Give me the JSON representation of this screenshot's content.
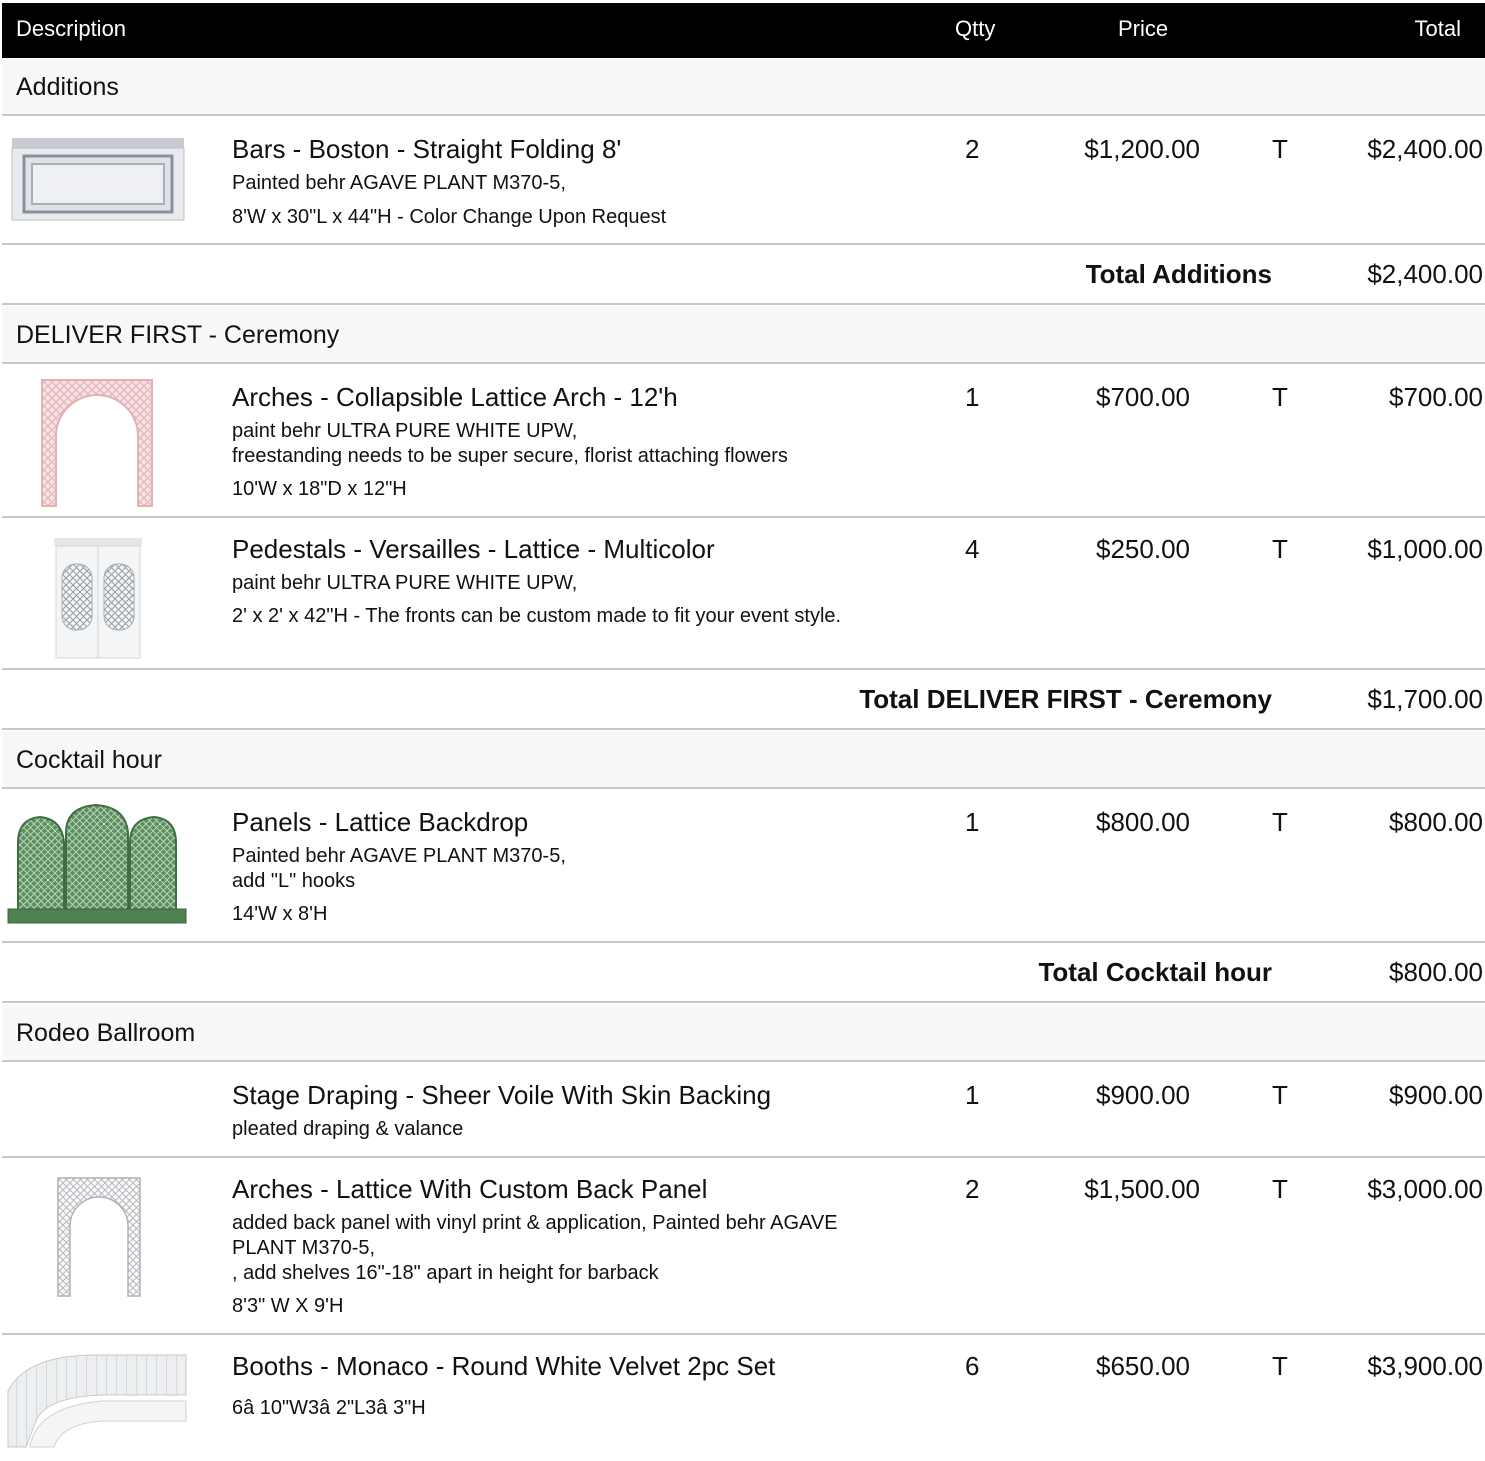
{
  "header": {
    "description": "Description",
    "qtty": "Qtty",
    "price": "Price",
    "total": "Total"
  },
  "sections": {
    "additions": {
      "title": "Additions",
      "items": [
        {
          "name": "Bars - Boston - Straight Folding 8'",
          "lines": [
            "Painted behr AGAVE PLANT M370-5,",
            "8'W x 30\"L x 44\"H - Color Change Upon Request"
          ],
          "qty": "2",
          "price": "$1,200.00",
          "tax": "T",
          "total": "$2,400.00"
        }
      ],
      "total_label": "Total Additions",
      "total_amount": "$2,400.00"
    },
    "ceremony": {
      "title": "DELIVER FIRST - Ceremony",
      "items": [
        {
          "name": "Arches - Collapsible Lattice Arch - 12'h",
          "lines": [
            "paint  behr ULTRA PURE WHITE UPW,",
            "freestanding needs to be super secure, florist attaching flowers",
            "10'W x 18\"D x 12\"H"
          ],
          "qty": "1",
          "price": "$700.00",
          "tax": "T",
          "total": "$700.00"
        },
        {
          "name": "Pedestals - Versailles - Lattice - Multicolor",
          "lines": [
            "paint  behr ULTRA PURE WHITE UPW,",
            "2' x 2' x 42\"H - The fronts can be custom made to fit your event style."
          ],
          "qty": "4",
          "price": "$250.00",
          "tax": "T",
          "total": "$1,000.00"
        }
      ],
      "total_label": "Total DELIVER FIRST - Ceremony",
      "total_amount": "$1,700.00"
    },
    "cocktail": {
      "title": "Cocktail hour",
      "items": [
        {
          "name": "Panels - Lattice Backdrop",
          "lines": [
            "Painted behr AGAVE PLANT M370-5,",
            "add \"L\" hooks",
            "14'W x 8'H"
          ],
          "qty": "1",
          "price": "$800.00",
          "tax": "T",
          "total": "$800.00"
        }
      ],
      "total_label": "Total Cocktail hour",
      "total_amount": "$800.00"
    },
    "rodeo": {
      "title": "Rodeo Ballroom",
      "items": [
        {
          "name": "Stage Draping - Sheer Voile With Skin Backing",
          "lines": [
            "pleated draping & valance"
          ],
          "qty": "1",
          "price": "$900.00",
          "tax": "T",
          "total": "$900.00"
        },
        {
          "name": "Arches - Lattice With Custom Back Panel",
          "lines": [
            "added back panel with vinyl print & application,  Painted behr AGAVE",
            "PLANT M370-5,",
            ", add shelves 16\"-18\" apart in height for barback",
            "8'3\" W X 9'H"
          ],
          "qty": "2",
          "price": "$1,500.00",
          "tax": "T",
          "total": "$3,000.00"
        },
        {
          "name": "Booths - Monaco - Round White Velvet 2pc Set",
          "lines": [
            "6â  10\"W3â  2\"L3â  3\"H"
          ],
          "qty": "6",
          "price": "$650.00",
          "tax": "T",
          "total": "$3,900.00"
        }
      ]
    }
  }
}
